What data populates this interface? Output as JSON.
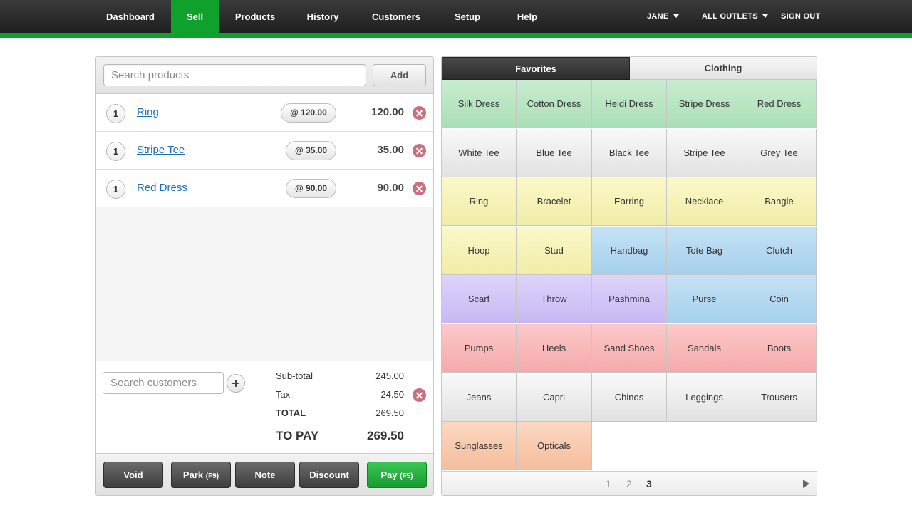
{
  "nav": {
    "items": [
      "Dashboard",
      "Sell",
      "Products",
      "History",
      "Customers",
      "Setup",
      "Help"
    ],
    "active": "Sell",
    "user": "JANE",
    "outlets": "ALL OUTLETS",
    "signout": "SIGN OUT"
  },
  "sale": {
    "search_placeholder": "Search products",
    "add_label": "Add",
    "items": [
      {
        "qty": "1",
        "name": "Ring",
        "unit_price": "@ 120.00",
        "total": "120.00"
      },
      {
        "qty": "1",
        "name": "Stripe Tee",
        "unit_price": "@ 35.00",
        "total": "35.00"
      },
      {
        "qty": "1",
        "name": "Red Dress",
        "unit_price": "@ 90.00",
        "total": "90.00"
      }
    ],
    "customer_placeholder": "Search customers",
    "totals": {
      "subtotal_label": "Sub-total",
      "subtotal": "245.00",
      "tax_label": "Tax",
      "tax": "24.50",
      "total_label": "TOTAL",
      "total": "269.50",
      "topay_label": "TO PAY",
      "topay": "269.50"
    },
    "actions": {
      "void": "Void",
      "park": "Park",
      "park_key": "(F9)",
      "note": "Note",
      "discount": "Discount",
      "pay": "Pay",
      "pay_key": "(F5)"
    }
  },
  "quickkeys": {
    "tabs": [
      "Favorites",
      "Clothing"
    ],
    "active_tab": "Favorites",
    "rows": [
      [
        {
          "label": "Silk Dress",
          "color": "green"
        },
        {
          "label": "Cotton Dress",
          "color": "green"
        },
        {
          "label": "Heidi Dress",
          "color": "green"
        },
        {
          "label": "Stripe Dress",
          "color": "green"
        },
        {
          "label": "Red Dress",
          "color": "green"
        }
      ],
      [
        {
          "label": "White Tee",
          "color": "gray"
        },
        {
          "label": "Blue Tee",
          "color": "gray"
        },
        {
          "label": "Black Tee",
          "color": "gray"
        },
        {
          "label": "Stripe Tee",
          "color": "gray"
        },
        {
          "label": "Grey Tee",
          "color": "gray"
        }
      ],
      [
        {
          "label": "Ring",
          "color": "yellow"
        },
        {
          "label": "Bracelet",
          "color": "yellow"
        },
        {
          "label": "Earring",
          "color": "yellow"
        },
        {
          "label": "Necklace",
          "color": "yellow"
        },
        {
          "label": "Bangle",
          "color": "yellow"
        }
      ],
      [
        {
          "label": "Hoop",
          "color": "yellow"
        },
        {
          "label": "Stud",
          "color": "yellow"
        },
        {
          "label": "Handbag",
          "color": "blue"
        },
        {
          "label": "Tote Bag",
          "color": "blue"
        },
        {
          "label": "Clutch",
          "color": "blue"
        }
      ],
      [
        {
          "label": "Scarf",
          "color": "purple"
        },
        {
          "label": "Throw",
          "color": "purple"
        },
        {
          "label": "Pashmina",
          "color": "purple"
        },
        {
          "label": "Purse",
          "color": "blue"
        },
        {
          "label": "Coin",
          "color": "blue"
        }
      ],
      [
        {
          "label": "Pumps",
          "color": "red"
        },
        {
          "label": "Heels",
          "color": "red"
        },
        {
          "label": "Sand Shoes",
          "color": "red"
        },
        {
          "label": "Sandals",
          "color": "red"
        },
        {
          "label": "Boots",
          "color": "red"
        }
      ],
      [
        {
          "label": "Jeans",
          "color": "gray"
        },
        {
          "label": "Capri",
          "color": "gray"
        },
        {
          "label": "Chinos",
          "color": "gray"
        },
        {
          "label": "Leggings",
          "color": "gray"
        },
        {
          "label": "Trousers",
          "color": "gray"
        }
      ],
      [
        {
          "label": "Sunglasses",
          "color": "orange"
        },
        {
          "label": "Opticals",
          "color": "orange"
        }
      ]
    ],
    "pages": [
      "1",
      "2",
      "3"
    ],
    "current_page": "3"
  }
}
